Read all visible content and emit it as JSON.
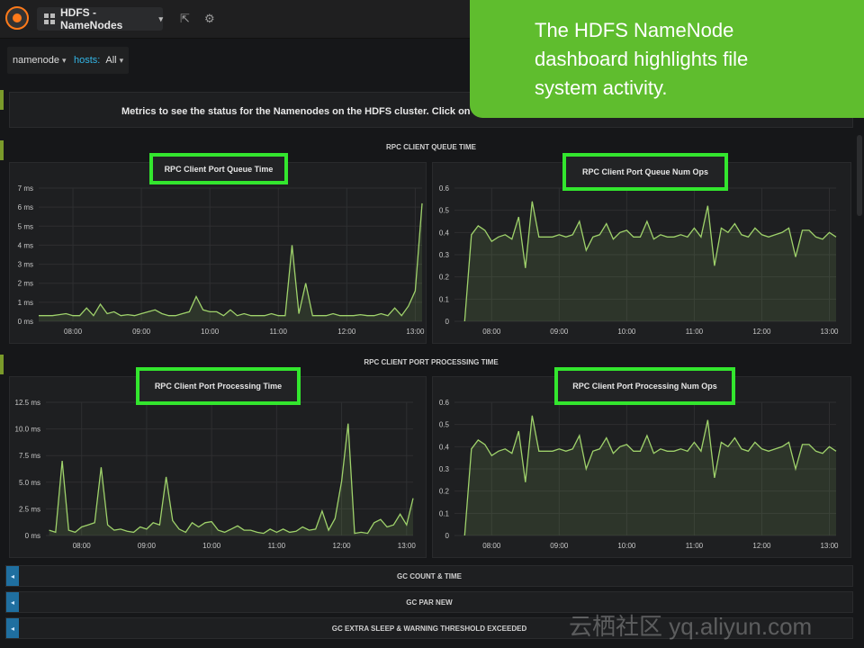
{
  "header": {
    "dashboard_title": "HDFS - NameNodes",
    "icons": [
      "grafana-logo-icon",
      "grid-icon",
      "share-icon",
      "gear-icon"
    ]
  },
  "filters": [
    {
      "label": "",
      "value": "namenode"
    },
    {
      "label": "hosts:",
      "value": "All"
    }
  ],
  "callout": {
    "text": "The HDFS NameNode dashboard highlights file system activity."
  },
  "description": "Metrics to see the status for the Namenodes on the HDFS cluster. Click on eac",
  "rows": [
    {
      "title": "RPC CLIENT QUEUE TIME"
    },
    {
      "title": "RPC CLIENT PORT PROCESSING TIME"
    }
  ],
  "collapsed_rows": [
    {
      "title": "GC COUNT & TIME"
    },
    {
      "title": "GC PAR NEW"
    },
    {
      "title": "GC EXTRA SLEEP & WARNING THRESHOLD EXCEEDED"
    }
  ],
  "watermark": "云栖社区 yq.aliyun.com",
  "colors": {
    "accent_green": "#33e62e",
    "callout_green": "#5fbd2e",
    "series_line": "#9fd26b",
    "background": "#161719"
  },
  "chart_data": [
    {
      "type": "area",
      "title": "RPC Client Port Queue Time",
      "x_ticks": [
        "08:00",
        "09:00",
        "10:00",
        "11:00",
        "12:00",
        "13:00"
      ],
      "y_ticks": [
        "0 ms",
        "1 ms",
        "2 ms",
        "3 ms",
        "4 ms",
        "5 ms",
        "6 ms",
        "7 ms"
      ],
      "xlim": [
        7.5,
        13.1
      ],
      "ylim": [
        0,
        7
      ],
      "x": [
        7.5,
        7.6,
        7.7,
        7.8,
        7.9,
        8.0,
        8.1,
        8.2,
        8.3,
        8.4,
        8.5,
        8.6,
        8.7,
        8.8,
        8.9,
        9.0,
        9.1,
        9.2,
        9.3,
        9.4,
        9.5,
        9.6,
        9.7,
        9.8,
        9.9,
        10.0,
        10.1,
        10.2,
        10.3,
        10.4,
        10.5,
        10.6,
        10.7,
        10.8,
        10.9,
        11.0,
        11.1,
        11.2,
        11.3,
        11.4,
        11.5,
        11.6,
        11.7,
        11.8,
        11.9,
        12.0,
        12.1,
        12.2,
        12.3,
        12.4,
        12.5,
        12.6,
        12.7,
        12.8,
        12.9,
        13.0,
        13.1
      ],
      "values": [
        0.3,
        0.3,
        0.3,
        0.35,
        0.4,
        0.3,
        0.3,
        0.7,
        0.3,
        0.9,
        0.4,
        0.5,
        0.3,
        0.35,
        0.3,
        0.4,
        0.5,
        0.6,
        0.4,
        0.3,
        0.3,
        0.4,
        0.5,
        1.3,
        0.6,
        0.5,
        0.5,
        0.3,
        0.6,
        0.3,
        0.4,
        0.3,
        0.3,
        0.3,
        0.4,
        0.3,
        0.3,
        4.0,
        0.4,
        2.0,
        0.3,
        0.3,
        0.3,
        0.4,
        0.3,
        0.3,
        0.3,
        0.35,
        0.3,
        0.3,
        0.4,
        0.3,
        0.7,
        0.3,
        0.8,
        1.6,
        6.2
      ],
      "color": "#9fd26b"
    },
    {
      "type": "area",
      "title": "RPC Client Port Queue Num Ops",
      "x_ticks": [
        "08:00",
        "09:00",
        "10:00",
        "11:00",
        "12:00",
        "13:00"
      ],
      "y_ticks": [
        "0",
        "0.1",
        "0.2",
        "0.3",
        "0.4",
        "0.5",
        "0.6"
      ],
      "xlim": [
        7.45,
        13.1
      ],
      "ylim": [
        0,
        0.6
      ],
      "x": [
        7.6,
        7.7,
        7.8,
        7.9,
        8.0,
        8.1,
        8.2,
        8.3,
        8.4,
        8.5,
        8.6,
        8.7,
        8.8,
        8.9,
        9.0,
        9.1,
        9.2,
        9.3,
        9.4,
        9.5,
        9.6,
        9.7,
        9.8,
        9.9,
        10.0,
        10.1,
        10.2,
        10.3,
        10.4,
        10.5,
        10.6,
        10.7,
        10.8,
        10.9,
        11.0,
        11.1,
        11.2,
        11.3,
        11.4,
        11.5,
        11.6,
        11.7,
        11.8,
        11.9,
        12.0,
        12.1,
        12.2,
        12.3,
        12.4,
        12.5,
        12.6,
        12.7,
        12.8,
        12.9,
        13.0,
        13.1
      ],
      "values": [
        0,
        0.39,
        0.43,
        0.41,
        0.36,
        0.38,
        0.39,
        0.37,
        0.47,
        0.24,
        0.54,
        0.38,
        0.38,
        0.38,
        0.39,
        0.38,
        0.39,
        0.45,
        0.32,
        0.38,
        0.39,
        0.44,
        0.37,
        0.4,
        0.41,
        0.38,
        0.38,
        0.45,
        0.37,
        0.39,
        0.38,
        0.38,
        0.39,
        0.38,
        0.42,
        0.38,
        0.52,
        0.25,
        0.42,
        0.4,
        0.44,
        0.39,
        0.38,
        0.42,
        0.39,
        0.38,
        0.39,
        0.4,
        0.42,
        0.29,
        0.41,
        0.41,
        0.38,
        0.37,
        0.4,
        0.38
      ],
      "color": "#9fd26b"
    },
    {
      "type": "area",
      "title": "RPC Client Port Processing Time",
      "x_ticks": [
        "08:00",
        "09:00",
        "10:00",
        "11:00",
        "12:00",
        "13:00"
      ],
      "y_ticks": [
        "0 ms",
        "2.5 ms",
        "5.0 ms",
        "7.5 ms",
        "10.0 ms",
        "12.5 ms"
      ],
      "xlim": [
        7.45,
        13.1
      ],
      "ylim": [
        0,
        12.5
      ],
      "x": [
        7.5,
        7.6,
        7.7,
        7.8,
        7.9,
        8.0,
        8.1,
        8.2,
        8.3,
        8.4,
        8.5,
        8.6,
        8.7,
        8.8,
        8.9,
        9.0,
        9.1,
        9.2,
        9.3,
        9.4,
        9.5,
        9.6,
        9.7,
        9.8,
        9.9,
        10.0,
        10.1,
        10.2,
        10.3,
        10.4,
        10.5,
        10.6,
        10.7,
        10.8,
        10.9,
        11.0,
        11.1,
        11.2,
        11.3,
        11.4,
        11.5,
        11.6,
        11.7,
        11.8,
        11.9,
        12.0,
        12.1,
        12.2,
        12.3,
        12.4,
        12.5,
        12.6,
        12.7,
        12.8,
        12.9,
        13.0,
        13.1
      ],
      "values": [
        0.5,
        0.3,
        7.0,
        0.5,
        0.3,
        0.8,
        1.0,
        1.2,
        6.4,
        1.0,
        0.5,
        0.6,
        0.4,
        0.3,
        0.8,
        0.6,
        1.2,
        1.0,
        5.5,
        1.4,
        0.6,
        0.3,
        1.2,
        0.8,
        1.2,
        1.3,
        0.5,
        0.3,
        0.6,
        0.9,
        0.5,
        0.5,
        0.3,
        0.2,
        0.6,
        0.3,
        0.6,
        0.3,
        0.4,
        0.8,
        0.5,
        0.6,
        2.3,
        0.5,
        1.6,
        5.1,
        10.5,
        0.2,
        0.3,
        0.2,
        1.2,
        1.5,
        0.8,
        1.0,
        2.0,
        1.0,
        3.5
      ],
      "color": "#9fd26b"
    },
    {
      "type": "area",
      "title": "RPC Client Port Processing Num Ops",
      "x_ticks": [
        "08:00",
        "09:00",
        "10:00",
        "11:00",
        "12:00",
        "13:00"
      ],
      "y_ticks": [
        "0",
        "0.1",
        "0.2",
        "0.3",
        "0.4",
        "0.5",
        "0.6"
      ],
      "xlim": [
        7.45,
        13.1
      ],
      "ylim": [
        0,
        0.6
      ],
      "x": [
        7.6,
        7.7,
        7.8,
        7.9,
        8.0,
        8.1,
        8.2,
        8.3,
        8.4,
        8.5,
        8.6,
        8.7,
        8.8,
        8.9,
        9.0,
        9.1,
        9.2,
        9.3,
        9.4,
        9.5,
        9.6,
        9.7,
        9.8,
        9.9,
        10.0,
        10.1,
        10.2,
        10.3,
        10.4,
        10.5,
        10.6,
        10.7,
        10.8,
        10.9,
        11.0,
        11.1,
        11.2,
        11.3,
        11.4,
        11.5,
        11.6,
        11.7,
        11.8,
        11.9,
        12.0,
        12.1,
        12.2,
        12.3,
        12.4,
        12.5,
        12.6,
        12.7,
        12.8,
        12.9,
        13.0,
        13.1
      ],
      "values": [
        0,
        0.39,
        0.43,
        0.41,
        0.36,
        0.38,
        0.39,
        0.37,
        0.47,
        0.24,
        0.54,
        0.38,
        0.38,
        0.38,
        0.39,
        0.38,
        0.39,
        0.45,
        0.3,
        0.38,
        0.39,
        0.44,
        0.37,
        0.4,
        0.41,
        0.38,
        0.38,
        0.45,
        0.37,
        0.39,
        0.38,
        0.38,
        0.39,
        0.38,
        0.42,
        0.38,
        0.52,
        0.26,
        0.42,
        0.4,
        0.44,
        0.39,
        0.38,
        0.42,
        0.39,
        0.38,
        0.39,
        0.4,
        0.42,
        0.3,
        0.41,
        0.41,
        0.38,
        0.37,
        0.4,
        0.38
      ],
      "color": "#9fd26b"
    }
  ]
}
